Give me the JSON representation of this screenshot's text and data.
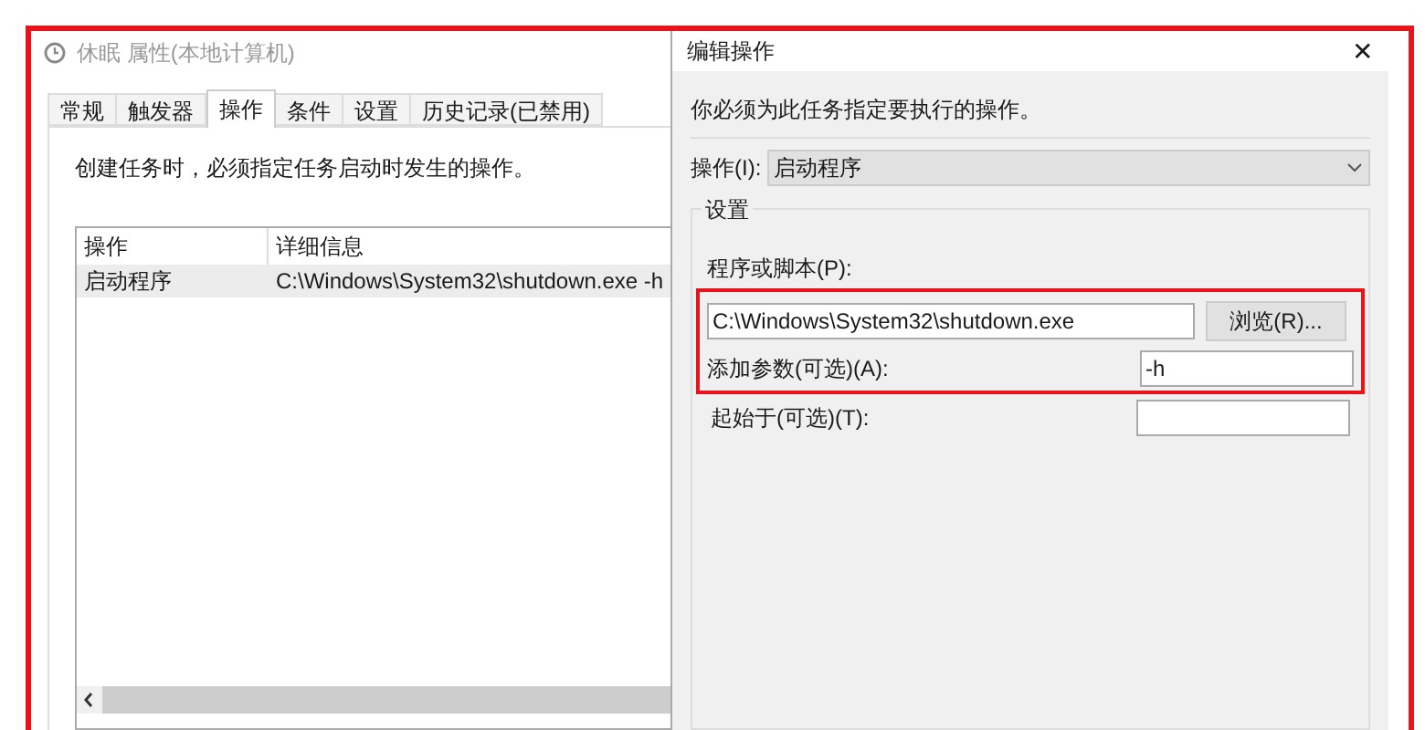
{
  "main_window": {
    "title": "休眠 属性(本地计算机)",
    "tabs": [
      {
        "label": "常规",
        "selected": false
      },
      {
        "label": "触发器",
        "selected": false
      },
      {
        "label": "操作",
        "selected": true
      },
      {
        "label": "条件",
        "selected": false
      },
      {
        "label": "设置",
        "selected": false
      },
      {
        "label": "历史记录(已禁用)",
        "selected": false
      }
    ],
    "description": "创建任务时，必须指定任务启动时发生的操作。",
    "table": {
      "columns": [
        "操作",
        "详细信息"
      ],
      "rows": [
        {
          "cells": [
            "启动程序",
            "C:\\Windows\\System32\\shutdown.exe -h"
          ],
          "selected": true
        }
      ]
    }
  },
  "edit_dialog": {
    "title": "编辑操作",
    "close": "✕",
    "instruction": "你必须为此任务指定要执行的操作。",
    "action": {
      "label": "操作(I):",
      "value": "启动程序"
    },
    "settings": {
      "title": "设置",
      "program_label": "程序或脚本(P):",
      "program_value": "C:\\Windows\\System32\\shutdown.exe",
      "browse_button": "浏览(R)...",
      "args_label": "添加参数(可选)(A):",
      "args_value": "-h",
      "start_label": "起始于(可选)(T):"
    }
  }
}
